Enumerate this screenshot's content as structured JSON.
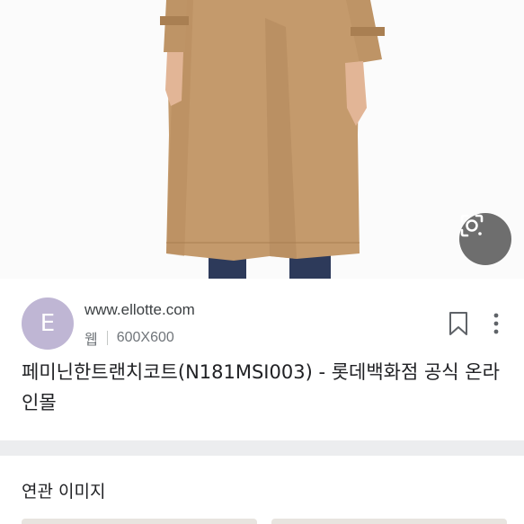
{
  "result": {
    "source_initial": "E",
    "domain": "www.ellotte.com",
    "type_label": "웹",
    "dimensions": "600X600",
    "title": "페미닌한트랜치코트(N181MSI003) - 롯데백화점 공식 온라인몰"
  },
  "related": {
    "section_title": "연관 이미지"
  },
  "icons": {
    "lens": "lens-search-icon",
    "bookmark": "bookmark-icon",
    "more": "more-vert-icon"
  },
  "colors": {
    "avatar_bg": "#bfb6d4",
    "coat": "#c49a6c",
    "lens_bg": "#555555"
  }
}
